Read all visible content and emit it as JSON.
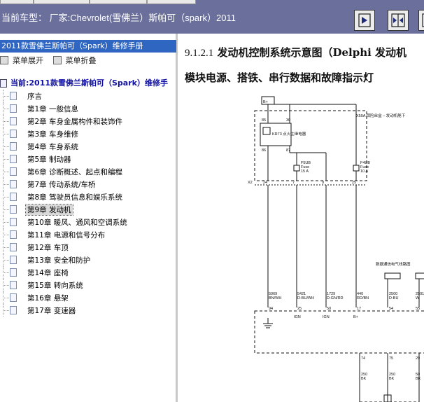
{
  "header": {
    "title": "当前车型：  厂家:Chevrolet(雪佛兰）斯帕可（spark）2011",
    "buttons": [
      "next-page-icon",
      "split-view-icon",
      "more-icon"
    ]
  },
  "sidebar": {
    "manual_title": "2011款雪佛兰斯帕可（Spark）维修手册",
    "expand_label": "菜单展开",
    "collapse_label": "菜单折叠",
    "current_label": "当前:2011款雪佛兰斯帕可（Spark）维修手",
    "items": [
      {
        "label": "序言"
      },
      {
        "label": "第1章 一般信息"
      },
      {
        "label": "第2章 车身金属构件和装饰件"
      },
      {
        "label": "第3章 车身维修"
      },
      {
        "label": "第4章 车身系统"
      },
      {
        "label": "第5章 制动器"
      },
      {
        "label": "第6章 诊断概述、起点和编程"
      },
      {
        "label": "第7章 传动系统/车桥"
      },
      {
        "label": "第8章 驾驶员信息和娱乐系统"
      },
      {
        "label": "第9章 发动机",
        "selected": true
      },
      {
        "label": "第10章 暖风、通风和空调系统"
      },
      {
        "label": "第11章 电源和信号分布"
      },
      {
        "label": "第12章 车顶"
      },
      {
        "label": "第13章 安全和防护"
      },
      {
        "label": "第14章 座椅"
      },
      {
        "label": "第15章 转向系统"
      },
      {
        "label": "第16章 悬架"
      },
      {
        "label": "第17章 变速器"
      }
    ]
  },
  "content": {
    "heading_number": "9.1.2.1",
    "heading_text": " 发动机控制系统示意图（Delphi 发动机",
    "heading_line2": "模块电源、搭铁、串行数据和故障指示灯",
    "diagram": {
      "top_label": "B+",
      "block_label": "X50A 保险丝盒 – 发动机舱下",
      "relay_label": "KR73 点火主继电器",
      "fuse1": [
        "F5UB",
        "Fuse",
        "15 A"
      ],
      "fuse2": [
        "F4UB",
        "Fuse",
        "10 A"
      ],
      "pins_top": [
        "85",
        "30",
        "86",
        "87"
      ],
      "connector": "X2",
      "connector_pins": [
        "24",
        "7",
        "9",
        "25"
      ],
      "wires": [
        {
          "num": "5069",
          "color": "BN/WH"
        },
        {
          "num": "5421",
          "color": "D-BU/WH"
        },
        {
          "num": "1729",
          "color": "D-GN/RD"
        },
        {
          "num": "440",
          "color": "RD/BN"
        },
        {
          "num": "2500",
          "color": "D-BU"
        },
        {
          "num": "2501",
          "color": "W"
        }
      ],
      "bus_label": "数据通信电气线路图",
      "module_pins": [
        "94",
        "25",
        "50",
        "17",
        "54",
        "55"
      ],
      "module_names": [
        "IGN",
        "IGN",
        "B+"
      ],
      "lower_pins": [
        "74",
        "75",
        "29"
      ],
      "lower_wires": [
        {
          "num": "250",
          "color": "BK"
        },
        {
          "num": "250",
          "color": "BK"
        },
        {
          "num": "50",
          "color": "BK"
        }
      ]
    }
  },
  "colors": {
    "topbar": "#6b6f9c",
    "selection": "#2f66c2"
  }
}
